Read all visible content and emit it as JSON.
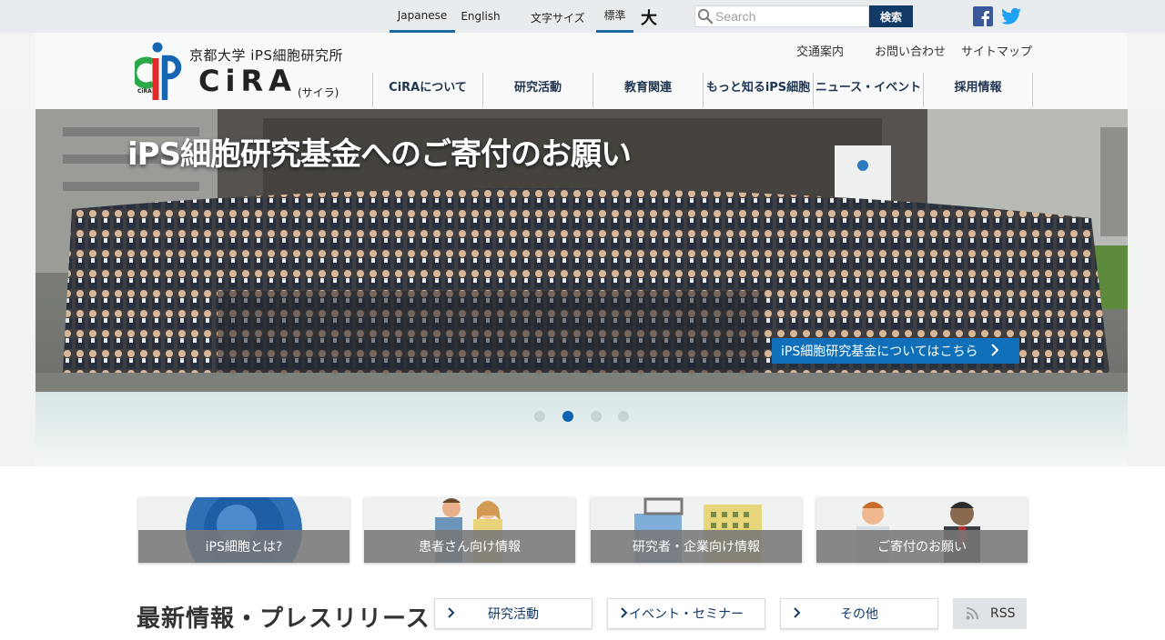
{
  "topbar": {
    "languages": [
      "Japanese",
      "English"
    ],
    "font_size_label": "文字サイズ",
    "font_size_standard": "標準",
    "font_size_large": "大",
    "search_placeholder": "Search",
    "search_button": "検索"
  },
  "header": {
    "logo_subtitle": "京都大学 iPS細胞研究所",
    "logo_name": "CiRA",
    "logo_kana": "(サイラ)",
    "logo_mark_text": "CiRA",
    "util_links": [
      "交通案内",
      "お問い合わせ",
      "サイトマップ"
    ],
    "nav": [
      "CiRAについて",
      "研究活動",
      "教育関連",
      "もっと知るiPS細胞",
      "ニュース・イベント",
      "採用情報"
    ]
  },
  "hero": {
    "title": "iPS細胞研究基金へのご寄付のお願い",
    "cta": "iPS細胞研究基金についてはこちら",
    "slides": 4,
    "active_slide": 2
  },
  "cards": [
    "iPS細胞とは?",
    "患者さん向け情報",
    "研究者・企業向け情報",
    "ご寄付のお願い"
  ],
  "news": {
    "title": "最新情報・プレスリリース",
    "filters": [
      "研究活動",
      "イベント・セミナー",
      "その他"
    ],
    "rss": "RSS"
  },
  "colors": {
    "accent": "#1b6aa5",
    "nav_text": "#1f3550",
    "search_button": "#123a66",
    "cta": "#0f6fb8",
    "facebook": "#3b5998",
    "twitter": "#1da1f2"
  },
  "icons": [
    "search-icon",
    "facebook-icon",
    "twitter-icon",
    "chevron-right-icon",
    "rss-icon"
  ]
}
